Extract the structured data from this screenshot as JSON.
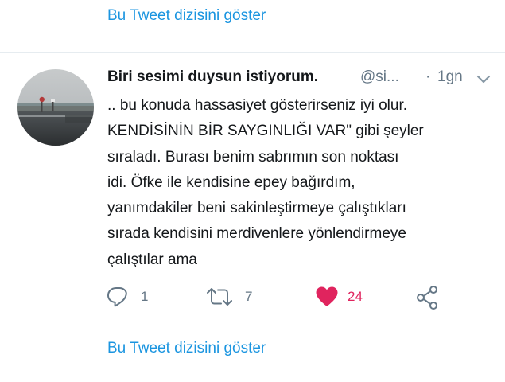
{
  "thread_link_top": "Bu Tweet dizisini göster",
  "thread_link_bottom": "Bu Tweet dizisini göster",
  "tweet": {
    "display_name": "Biri sesimi duysun istiyorum.",
    "handle": "@si...",
    "separator": "·",
    "timestamp": "1gn",
    "text_lines": [
      ".. bu konuda hassasiyet gösterirseniz iyi olur.",
      "KENDİSİNİN BİR SAYGINLIĞI VAR\" gibi şeyler",
      "sıraladı. Burası benim sabrımın son noktası",
      "idi. Öfke ile kendisine epey bağırdım,",
      "yanımdakiler beni sakinleştirmeye çalıştıkları",
      "sırada kendisini merdivenlere yönlendirmeye",
      "çalıştılar ama"
    ],
    "actions": {
      "reply": {
        "icon": "reply-icon",
        "count": "1"
      },
      "retweet": {
        "icon": "retweet-icon",
        "count": "7"
      },
      "like": {
        "icon": "heart-icon",
        "count": "24",
        "liked": true,
        "color": "#e0245e"
      },
      "share": {
        "icon": "share-icon"
      }
    }
  },
  "colors": {
    "link": "#1b95e0",
    "secondary_text": "#657786",
    "like": "#e0245e",
    "divider": "#e6ecf0"
  }
}
